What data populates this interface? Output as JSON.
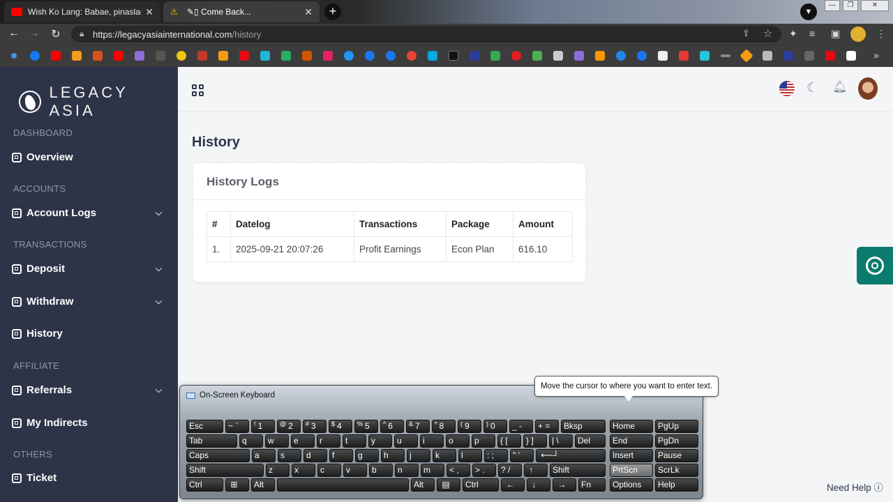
{
  "browser": {
    "tabs": [
      {
        "title": "Wish Ko Lang: Babae, pinaslang",
        "favicon": "youtube-icon",
        "color": "#ff0000"
      },
      {
        "title": "✎▯ Come Back...",
        "favicon": "warning-icon",
        "color": "#f2c400"
      }
    ],
    "url_host": "https://legacyasiainternational.com",
    "url_path": "/history",
    "overflow_label": "»"
  },
  "brand": {
    "name": "LEGACY ASIA"
  },
  "sidebar": {
    "sections": {
      "dashboard": "DASHBOARD",
      "accounts": "ACCOUNTS",
      "transactions": "TRANSACTIONS",
      "affiliate": "AFFILIATE",
      "others": "OTHERS"
    },
    "items": [
      {
        "label": "Overview"
      },
      {
        "label": "Account Logs"
      },
      {
        "label": "Deposit"
      },
      {
        "label": "Withdraw"
      },
      {
        "label": "History"
      },
      {
        "label": "Referrals"
      },
      {
        "label": "My Indirects"
      },
      {
        "label": "Ticket"
      }
    ]
  },
  "page": {
    "title": "History",
    "card_title": "History Logs",
    "table": {
      "headers": [
        "#",
        "Datelog",
        "Transactions",
        "Package",
        "Amount"
      ],
      "rows": [
        [
          "1.",
          "2025-09-21 20:07:26",
          "Profit Earnings",
          "Econ Plan",
          "616.10"
        ]
      ]
    },
    "need_help": "Need Help ⓘ"
  },
  "osk": {
    "title": "On-Screen Keyboard",
    "tooltip": "Move the cursor to where you want to enter text."
  },
  "colors": {
    "sidebar": "#2e3448",
    "accent": "#0b7b6e"
  }
}
